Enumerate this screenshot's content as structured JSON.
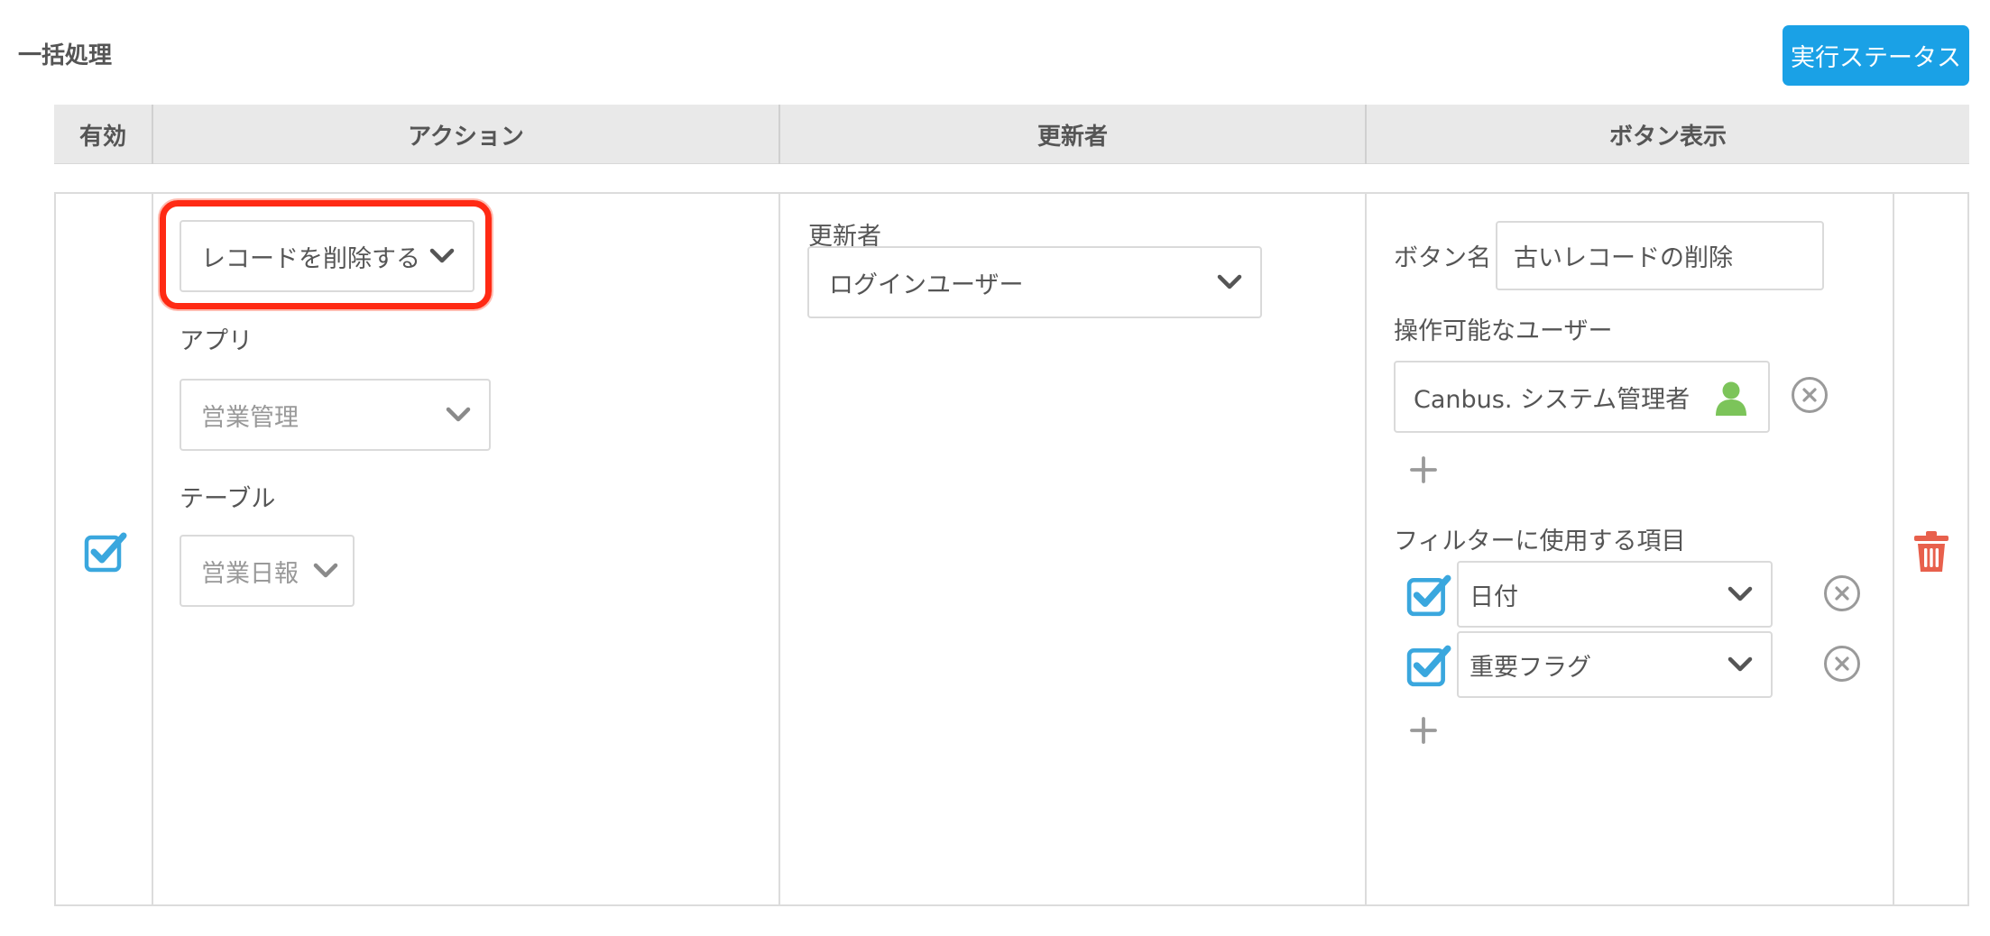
{
  "page": {
    "title": "一括処理",
    "status_button": "実行ステータス"
  },
  "table": {
    "headers": {
      "enabled": "有効",
      "action": "アクション",
      "updater": "更新者",
      "button_display": "ボタン表示"
    }
  },
  "row": {
    "enabled": true,
    "action_select": "レコードを削除する",
    "app_label": "アプリ",
    "app_select": "営業管理",
    "table_label": "テーブル",
    "table_select": "営業日報",
    "updater_label": "更新者",
    "updater_select": "ログインユーザー",
    "button_name_label": "ボタン名",
    "button_name_value": "古いレコードの削除",
    "operable_users_label": "操作可能なユーザー",
    "operable_user": "Canbus. システム管理者",
    "filter_label": "フィルターに使用する項目",
    "filters": [
      {
        "checked": true,
        "field": "日付"
      },
      {
        "checked": true,
        "field": "重要フラグ"
      }
    ]
  },
  "colors": {
    "accent": "#1aa1e6",
    "checkbox": "#3aa7de",
    "delete": "#e8604c",
    "user_icon": "#7cc45a",
    "highlight": "#ff2a14"
  }
}
